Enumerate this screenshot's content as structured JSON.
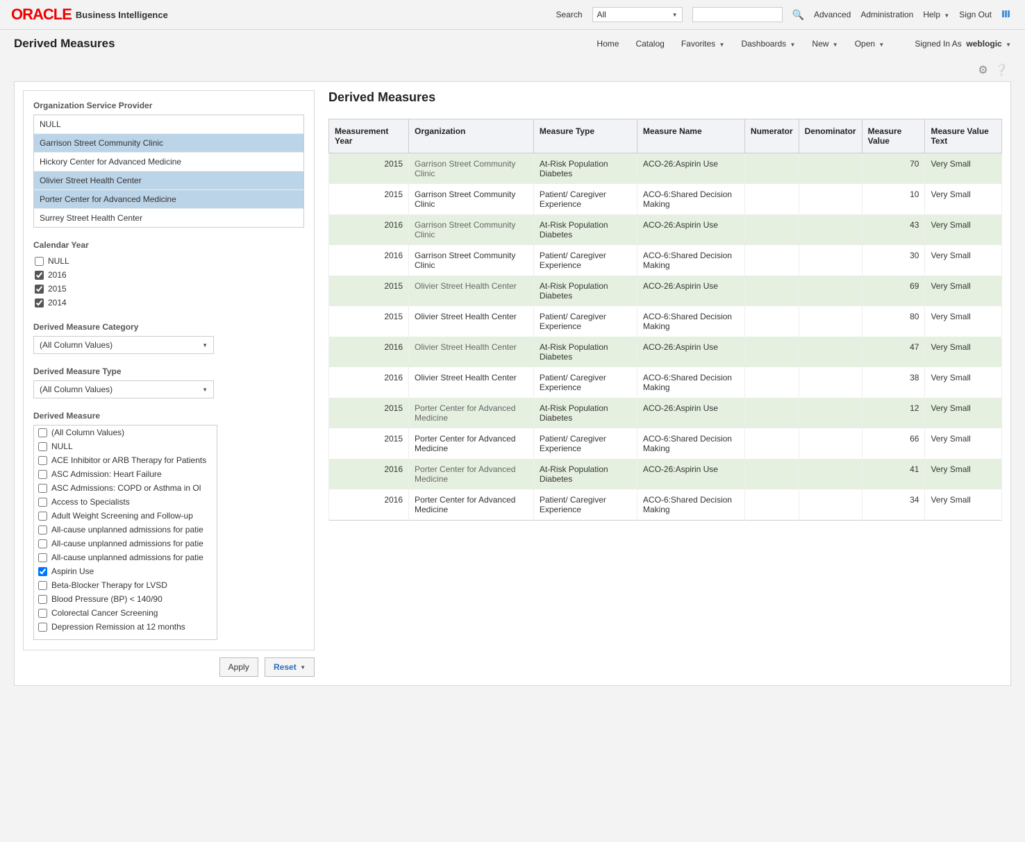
{
  "header": {
    "logo": "ORACLE",
    "logo_sub": "Business Intelligence",
    "search_label": "Search",
    "search_select": "All",
    "advanced": "Advanced",
    "administration": "Administration",
    "help": "Help",
    "sign_out": "Sign Out"
  },
  "nav": {
    "page_title": "Derived Measures",
    "home": "Home",
    "catalog": "Catalog",
    "favorites": "Favorites",
    "dashboards": "Dashboards",
    "new": "New",
    "open": "Open",
    "signed_in_label": "Signed In As",
    "user": "weblogic"
  },
  "filters": {
    "org_label": "Organization Service Provider",
    "orgs": [
      {
        "label": "NULL",
        "sel": false
      },
      {
        "label": "Garrison Street Community Clinic",
        "sel": true
      },
      {
        "label": "Hickory Center for Advanced Medicine",
        "sel": false
      },
      {
        "label": "Olivier Street Health Center",
        "sel": true
      },
      {
        "label": "Porter Center for Advanced Medicine",
        "sel": true
      },
      {
        "label": "Surrey Street Health Center",
        "sel": false
      }
    ],
    "year_label": "Calendar Year",
    "years": [
      {
        "label": "NULL",
        "checked": false
      },
      {
        "label": "2016",
        "checked": true
      },
      {
        "label": "2015",
        "checked": true
      },
      {
        "label": "2014",
        "checked": true
      }
    ],
    "cat_label": "Derived Measure Category",
    "cat_value": "(All Column Values)",
    "type_label": "Derived Measure Type",
    "type_value": "(All Column Values)",
    "measure_label": "Derived Measure",
    "measures": [
      {
        "label": "(All Column Values)",
        "checked": false
      },
      {
        "label": "NULL",
        "checked": false
      },
      {
        "label": "ACE Inhibitor or ARB Therapy for Patients",
        "checked": false
      },
      {
        "label": "ASC Admission: Heart Failure",
        "checked": false
      },
      {
        "label": "ASC Admissions: COPD or Asthma in Ol",
        "checked": false
      },
      {
        "label": "Access to Specialists",
        "checked": false
      },
      {
        "label": "Adult Weight Screening and Follow-up",
        "checked": false
      },
      {
        "label": "All-cause unplanned admissions for patie",
        "checked": false
      },
      {
        "label": "All-cause unplanned admissions for patie",
        "checked": false
      },
      {
        "label": "All-cause unplanned admissions for patie",
        "checked": false
      },
      {
        "label": "Aspirin Use",
        "checked": true
      },
      {
        "label": "Beta-Blocker Therapy for LVSD",
        "checked": false
      },
      {
        "label": "Blood Pressure (BP) < 140/90",
        "checked": false
      },
      {
        "label": "Colorectal Cancer Screening",
        "checked": false
      },
      {
        "label": "Depression Remission at 12 months",
        "checked": false
      }
    ],
    "apply": "Apply",
    "reset": "Reset"
  },
  "results": {
    "title": "Derived Measures",
    "headers": [
      "Measurement Year",
      "Organization",
      "Measure Type",
      "Measure Name",
      "Numerator",
      "Denominator",
      "Measure Value",
      "Measure Value Text"
    ],
    "rows": [
      {
        "year": "2015",
        "org": "Garrison Street Community Clinic",
        "mtype": "At-Risk Population Diabetes",
        "mname": "ACO-26:Aspirin Use",
        "num": "",
        "den": "",
        "mval": "70",
        "mvt": "Very Small",
        "cls": "a"
      },
      {
        "year": "2015",
        "org": "Garrison Street Community Clinic",
        "mtype": "Patient/ Caregiver Experience",
        "mname": "ACO-6:Shared Decision Making",
        "num": "",
        "den": "",
        "mval": "10",
        "mvt": "Very Small",
        "cls": "b"
      },
      {
        "year": "2016",
        "org": "Garrison Street Community Clinic",
        "mtype": "At-Risk Population Diabetes",
        "mname": "ACO-26:Aspirin Use",
        "num": "",
        "den": "",
        "mval": "43",
        "mvt": "Very Small",
        "cls": "a"
      },
      {
        "year": "2016",
        "org": "Garrison Street Community Clinic",
        "mtype": "Patient/ Caregiver Experience",
        "mname": "ACO-6:Shared Decision Making",
        "num": "",
        "den": "",
        "mval": "30",
        "mvt": "Very Small",
        "cls": "b"
      },
      {
        "year": "2015",
        "org": "Olivier Street Health Center",
        "mtype": "At-Risk Population Diabetes",
        "mname": "ACO-26:Aspirin Use",
        "num": "",
        "den": "",
        "mval": "69",
        "mvt": "Very Small",
        "cls": "a"
      },
      {
        "year": "2015",
        "org": "Olivier Street Health Center",
        "mtype": "Patient/ Caregiver Experience",
        "mname": "ACO-6:Shared Decision Making",
        "num": "",
        "den": "",
        "mval": "80",
        "mvt": "Very Small",
        "cls": "b"
      },
      {
        "year": "2016",
        "org": "Olivier Street Health Center",
        "mtype": "At-Risk Population Diabetes",
        "mname": "ACO-26:Aspirin Use",
        "num": "",
        "den": "",
        "mval": "47",
        "mvt": "Very Small",
        "cls": "a"
      },
      {
        "year": "2016",
        "org": "Olivier Street Health Center",
        "mtype": "Patient/ Caregiver Experience",
        "mname": "ACO-6:Shared Decision Making",
        "num": "",
        "den": "",
        "mval": "38",
        "mvt": "Very Small",
        "cls": "b"
      },
      {
        "year": "2015",
        "org": "Porter Center for Advanced Medicine",
        "mtype": "At-Risk Population Diabetes",
        "mname": "ACO-26:Aspirin Use",
        "num": "",
        "den": "",
        "mval": "12",
        "mvt": "Very Small",
        "cls": "a"
      },
      {
        "year": "2015",
        "org": "Porter Center for Advanced Medicine",
        "mtype": "Patient/ Caregiver Experience",
        "mname": "ACO-6:Shared Decision Making",
        "num": "",
        "den": "",
        "mval": "66",
        "mvt": "Very Small",
        "cls": "b"
      },
      {
        "year": "2016",
        "org": "Porter Center for Advanced Medicine",
        "mtype": "At-Risk Population Diabetes",
        "mname": "ACO-26:Aspirin Use",
        "num": "",
        "den": "",
        "mval": "41",
        "mvt": "Very Small",
        "cls": "a"
      },
      {
        "year": "2016",
        "org": "Porter Center for Advanced Medicine",
        "mtype": "Patient/ Caregiver Experience",
        "mname": "ACO-6:Shared Decision Making",
        "num": "",
        "den": "",
        "mval": "34",
        "mvt": "Very Small",
        "cls": "b"
      }
    ]
  }
}
